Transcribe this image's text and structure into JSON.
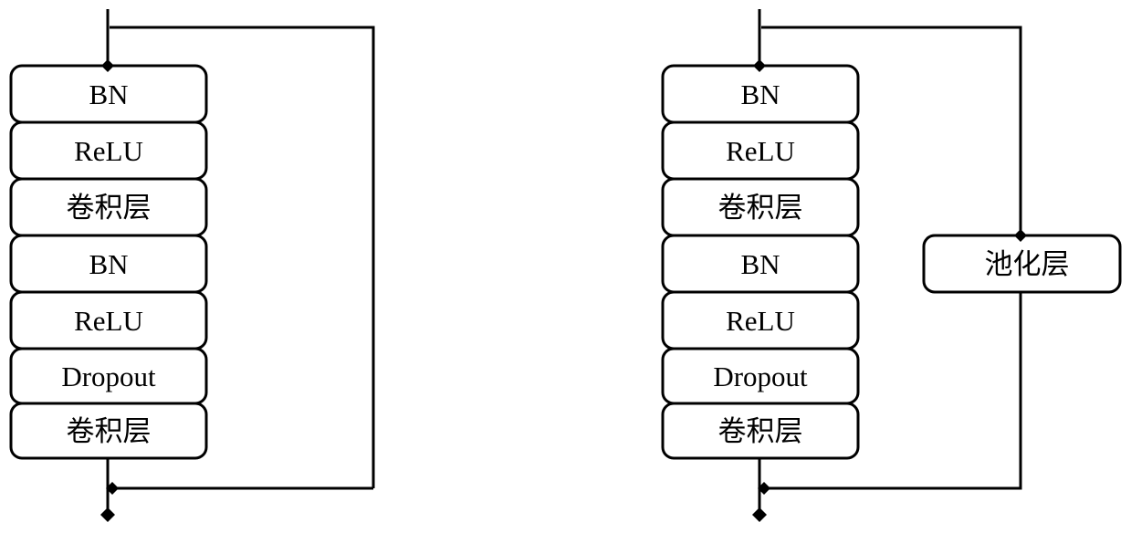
{
  "diagram": {
    "left_block": {
      "layers": [
        "BN",
        "ReLU",
        "卷积层",
        "BN",
        "ReLU",
        "Dropout",
        "卷积层"
      ],
      "shortcut": "identity"
    },
    "right_block": {
      "layers": [
        "BN",
        "ReLU",
        "卷积层",
        "BN",
        "ReLU",
        "Dropout",
        "卷积层"
      ],
      "shortcut_layer": "池化层"
    },
    "colors": {
      "stroke": "#000000",
      "fill": "#ffffff"
    }
  }
}
